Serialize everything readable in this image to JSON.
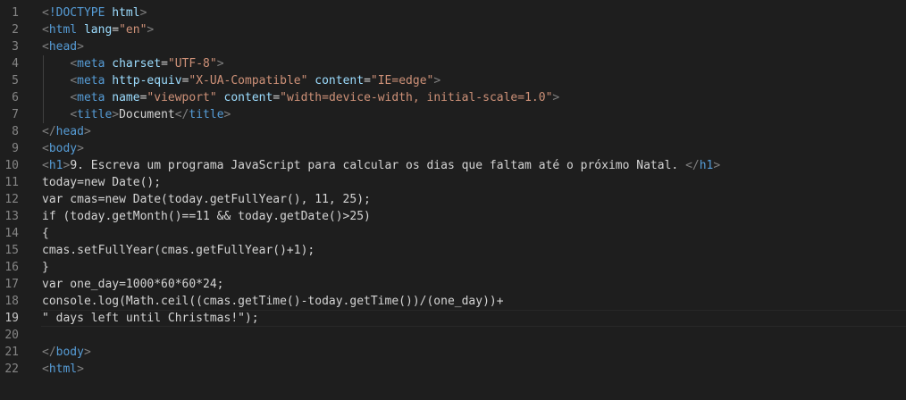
{
  "editor": {
    "top_fragment": "          ",
    "current_line": 19,
    "lines": [
      {
        "n": "1",
        "tokens": [
          [
            "br",
            "<"
          ],
          [
            "tag",
            "!DOCTYPE"
          ],
          [
            "txt",
            " "
          ],
          [
            "attr",
            "html"
          ],
          [
            "br",
            ">"
          ]
        ]
      },
      {
        "n": "2",
        "tokens": [
          [
            "br",
            "<"
          ],
          [
            "tag",
            "html"
          ],
          [
            "txt",
            " "
          ],
          [
            "attr",
            "lang"
          ],
          [
            "txt",
            "="
          ],
          [
            "str",
            "\"en\""
          ],
          [
            "br",
            ">"
          ]
        ]
      },
      {
        "n": "3",
        "tokens": [
          [
            "br",
            "<"
          ],
          [
            "tag",
            "head"
          ],
          [
            "br",
            ">"
          ]
        ]
      },
      {
        "n": "4",
        "tokens": [
          [
            "txt",
            "    "
          ],
          [
            "br",
            "<"
          ],
          [
            "tag",
            "meta"
          ],
          [
            "txt",
            " "
          ],
          [
            "attr",
            "charset"
          ],
          [
            "txt",
            "="
          ],
          [
            "str",
            "\"UTF-8\""
          ],
          [
            "br",
            ">"
          ]
        ]
      },
      {
        "n": "5",
        "tokens": [
          [
            "txt",
            "    "
          ],
          [
            "br",
            "<"
          ],
          [
            "tag",
            "meta"
          ],
          [
            "txt",
            " "
          ],
          [
            "attr",
            "http-equiv"
          ],
          [
            "txt",
            "="
          ],
          [
            "str",
            "\"X-UA-Compatible\""
          ],
          [
            "txt",
            " "
          ],
          [
            "attr",
            "content"
          ],
          [
            "txt",
            "="
          ],
          [
            "str",
            "\"IE=edge\""
          ],
          [
            "br",
            ">"
          ]
        ]
      },
      {
        "n": "6",
        "tokens": [
          [
            "txt",
            "    "
          ],
          [
            "br",
            "<"
          ],
          [
            "tag",
            "meta"
          ],
          [
            "txt",
            " "
          ],
          [
            "attr",
            "name"
          ],
          [
            "txt",
            "="
          ],
          [
            "str",
            "\"viewport\""
          ],
          [
            "txt",
            " "
          ],
          [
            "attr",
            "content"
          ],
          [
            "txt",
            "="
          ],
          [
            "str",
            "\"width=device-width, initial-scale=1.0\""
          ],
          [
            "br",
            ">"
          ]
        ]
      },
      {
        "n": "7",
        "tokens": [
          [
            "txt",
            "    "
          ],
          [
            "br",
            "<"
          ],
          [
            "tag",
            "title"
          ],
          [
            "br",
            ">"
          ],
          [
            "txt",
            "Document"
          ],
          [
            "br",
            "</"
          ],
          [
            "tag",
            "title"
          ],
          [
            "br",
            ">"
          ]
        ]
      },
      {
        "n": "8",
        "tokens": [
          [
            "br",
            "</"
          ],
          [
            "tag",
            "head"
          ],
          [
            "br",
            ">"
          ]
        ]
      },
      {
        "n": "9",
        "tokens": [
          [
            "br",
            "<"
          ],
          [
            "tag",
            "body"
          ],
          [
            "br",
            ">"
          ]
        ]
      },
      {
        "n": "10",
        "tokens": [
          [
            "br",
            "<"
          ],
          [
            "tag",
            "h1"
          ],
          [
            "br",
            ">"
          ],
          [
            "txt",
            "9. Escreva um programa JavaScript para calcular os dias que faltam até o próximo Natal. "
          ],
          [
            "br",
            "</"
          ],
          [
            "tag",
            "h1"
          ],
          [
            "br",
            ">"
          ]
        ]
      },
      {
        "n": "11",
        "tokens": [
          [
            "txt",
            "today=new Date();"
          ]
        ]
      },
      {
        "n": "12",
        "tokens": [
          [
            "txt",
            "var cmas=new Date(today.getFullYear(), 11, 25);"
          ]
        ]
      },
      {
        "n": "13",
        "tokens": [
          [
            "txt",
            "if (today.getMonth()==11 && today.getDate()>25)"
          ]
        ]
      },
      {
        "n": "14",
        "tokens": [
          [
            "txt",
            "{"
          ]
        ]
      },
      {
        "n": "15",
        "tokens": [
          [
            "txt",
            "cmas.setFullYear(cmas.getFullYear()+1);"
          ]
        ]
      },
      {
        "n": "16",
        "tokens": [
          [
            "txt",
            "}"
          ]
        ]
      },
      {
        "n": "17",
        "tokens": [
          [
            "txt",
            "var one_day=1000*60*60*24;"
          ]
        ]
      },
      {
        "n": "18",
        "tokens": [
          [
            "txt",
            "console.log(Math.ceil((cmas.getTime()-today.getTime())/(one_day))+"
          ]
        ]
      },
      {
        "n": "19",
        "tokens": [
          [
            "txt",
            "\" days left until Christmas!\");"
          ]
        ]
      },
      {
        "n": "20",
        "tokens": []
      },
      {
        "n": "21",
        "tokens": [
          [
            "br",
            "</"
          ],
          [
            "tag",
            "body"
          ],
          [
            "br",
            ">"
          ]
        ]
      },
      {
        "n": "22",
        "tokens": [
          [
            "br",
            "<"
          ],
          [
            "tag",
            "html"
          ],
          [
            "br",
            ">"
          ]
        ]
      }
    ]
  }
}
